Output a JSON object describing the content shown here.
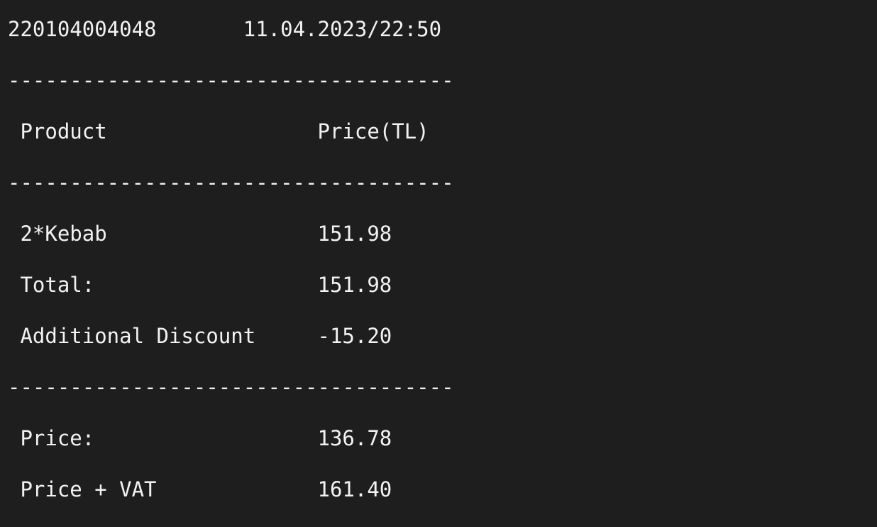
{
  "terminal": {
    "lines": [
      "220104004048       11.04.2023/22:50",
      "------------------------------------",
      " Product                 Price(TL)",
      "------------------------------------",
      " 2*Kebab                 151.98",
      " Total:                  151.98",
      " Additional Discount     -15.20",
      "------------------------------------",
      " Price:                  136.78",
      " Price + VAT             161.40"
    ]
  }
}
